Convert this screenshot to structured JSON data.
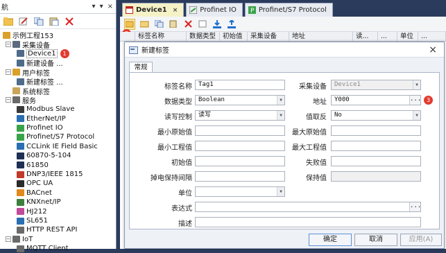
{
  "left_panel": {
    "title": "航",
    "controls": [
      "▾",
      "▾",
      "×"
    ],
    "tree": [
      {
        "label": "示例工程153",
        "indent": 0,
        "icon": "project-icon",
        "color": "#d9a12a",
        "exp": ""
      },
      {
        "label": "采集设备",
        "indent": 1,
        "icon": "device-folder-icon",
        "color": "#5d6b7d",
        "exp": "−"
      },
      {
        "label": "Device1",
        "indent": 2,
        "icon": "device-icon",
        "color": "#4f6b8a",
        "exp": "",
        "badge": "1",
        "selected": true
      },
      {
        "label": "新建设备 ...",
        "indent": 2,
        "icon": "new-device-icon",
        "color": "#4f6b8a",
        "exp": ""
      },
      {
        "label": "用户标签",
        "indent": 1,
        "icon": "user-tag-icon",
        "color": "#d9a12a",
        "exp": "−"
      },
      {
        "label": "新建标签 ...",
        "indent": 2,
        "icon": "new-tag-icon",
        "color": "#4f6b8a",
        "exp": ""
      },
      {
        "label": "系统标签",
        "indent": 1,
        "icon": "system-tag-icon",
        "color": "#c9a55a",
        "exp": ""
      },
      {
        "label": "服务",
        "indent": 1,
        "icon": "service-icon",
        "color": "#6a6a6a",
        "exp": "−"
      },
      {
        "label": "Modbus Slave",
        "indent": 2,
        "icon": "modbus-icon",
        "color": "#3a3a3a",
        "exp": ""
      },
      {
        "label": "EtherNet/IP",
        "indent": 2,
        "icon": "ethernetip-icon",
        "color": "#2a6fb4",
        "exp": ""
      },
      {
        "label": "Profinet IO",
        "indent": 2,
        "icon": "profinet-icon",
        "color": "#3aa34a",
        "exp": ""
      },
      {
        "label": "Profinet/S7 Protocol",
        "indent": 2,
        "icon": "s7-icon",
        "color": "#3aa34a",
        "exp": ""
      },
      {
        "label": "CCLink IE Field Basic",
        "indent": 2,
        "icon": "cclink-icon",
        "color": "#2a6fb4",
        "exp": ""
      },
      {
        "label": "60870-5-104",
        "indent": 2,
        "icon": "iec104-icon",
        "color": "#1d2f55",
        "exp": ""
      },
      {
        "label": "61850",
        "indent": 2,
        "icon": "iec61850-icon",
        "color": "#1d2f55",
        "exp": ""
      },
      {
        "label": "DNP3/IEEE 1815",
        "indent": 2,
        "icon": "dnp3-icon",
        "color": "#c0392b",
        "exp": ""
      },
      {
        "label": "OPC UA",
        "indent": 2,
        "icon": "opcua-icon",
        "color": "#2a2a2a",
        "exp": ""
      },
      {
        "label": "BACnet",
        "indent": 2,
        "icon": "bacnet-icon",
        "color": "#e08a1e",
        "exp": ""
      },
      {
        "label": "KNXnet/IP",
        "indent": 2,
        "icon": "knx-icon",
        "color": "#3c7f3c",
        "exp": ""
      },
      {
        "label": "HJ212",
        "indent": 2,
        "icon": "hj212-icon",
        "color": "#c24a9a",
        "exp": ""
      },
      {
        "label": "SL651",
        "indent": 2,
        "icon": "sl651-icon",
        "color": "#2a6fb4",
        "exp": ""
      },
      {
        "label": "HTTP REST API",
        "indent": 2,
        "icon": "http-icon",
        "color": "#6a6a6a",
        "exp": ""
      },
      {
        "label": "IoT",
        "indent": 1,
        "icon": "iot-icon",
        "color": "#6a6a6a",
        "exp": "−"
      },
      {
        "label": "MQTT Client",
        "indent": 2,
        "icon": "mqtt-icon",
        "color": "#6a6a6a",
        "exp": ""
      }
    ]
  },
  "tabs": [
    {
      "label": "Device1",
      "close": "×",
      "active": true
    },
    {
      "label": "Profinet IO",
      "close": "",
      "active": false
    },
    {
      "label": "Profinet/S7 Protocol",
      "close": "",
      "active": false
    }
  ],
  "toolbar_badge": "2",
  "columns": [
    "标签名称",
    "数据类型",
    "初始值",
    "采集设备",
    "地址",
    "读...",
    "...",
    "单位",
    "..."
  ],
  "dialog": {
    "title": "新建标签",
    "close": "×",
    "tab": "常规",
    "fields": {
      "tag_name": {
        "label": "标签名称",
        "value": "Tag1"
      },
      "data_type": {
        "label": "数据类型",
        "value": "Boolean"
      },
      "rw": {
        "label": "读写控制",
        "value": "读写"
      },
      "min_raw": {
        "label": "最小原始值",
        "value": ""
      },
      "min_eng": {
        "label": "最小工程值",
        "value": ""
      },
      "init": {
        "label": "初始值",
        "value": ""
      },
      "retain": {
        "label": "掉电保持间隔",
        "value": ""
      },
      "unit": {
        "label": "单位",
        "value": ""
      },
      "expr": {
        "label": "表达式",
        "value": ""
      },
      "desc": {
        "label": "描述",
        "value": ""
      },
      "device": {
        "label": "采集设备",
        "value": "Device1"
      },
      "address": {
        "label": "地址",
        "value": "Y000"
      },
      "negate": {
        "label": "值取反",
        "value": "No"
      },
      "max_raw": {
        "label": "最大原始值",
        "value": ""
      },
      "max_eng": {
        "label": "最大工程值",
        "value": ""
      },
      "fail": {
        "label": "失败值",
        "value": ""
      },
      "hold": {
        "label": "保持值",
        "value": ""
      }
    },
    "dots": "...",
    "address_badge": "3",
    "buttons": {
      "ok": "确定",
      "cancel": "取消",
      "apply": "应用(A)"
    }
  }
}
